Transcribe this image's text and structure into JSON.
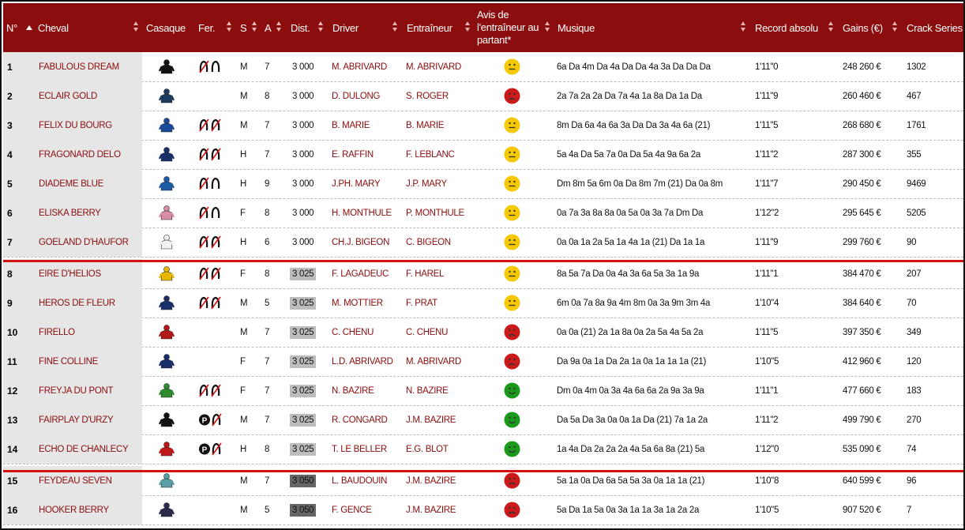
{
  "header": {
    "num": "N°",
    "cheval": "Cheval",
    "casaque": "Casaque",
    "fer": "Fer.",
    "s": "S",
    "a": "A",
    "dist": "Dist.",
    "driver": "Driver",
    "entraineur": "Entraîneur",
    "avis_l1": "Avis de",
    "avis_l2": "l'entraîneur au",
    "avis_l3": "partant*",
    "musique": "Musique",
    "record": "Record absolu",
    "gains": "Gains (€)",
    "crack": "Crack Series"
  },
  "colors": {
    "header_bg": "#8b0d0d",
    "separator": "#d41111",
    "good": "#1a9a1a",
    "neutral": "#f5c800",
    "bad": "#cc1a1a"
  },
  "rows": [
    {
      "num": "1",
      "cheval": "FABULOUS DREAM",
      "casaque": "jockey-silk-black",
      "casaque_color": "#111111",
      "fer": "D4 shoes",
      "fer_icon": "horseshoe-partial-icon",
      "s": "M",
      "a": "7",
      "dist": "3 000",
      "dist_style": "plain",
      "driver": "M. ABRIVARD",
      "entraineur": "M. ABRIVARD",
      "avis": "neutral",
      "musique": "6a Da 4m Da 4a Da Da 4a 3a Da Da Da",
      "record": "1'11\"0",
      "gains": "248 260 €",
      "crack": "1302"
    },
    {
      "num": "2",
      "cheval": "ECLAIR GOLD",
      "casaque": "jockey-silk-navy",
      "casaque_color": "#1d3b5c",
      "fer": "",
      "fer_icon": "",
      "s": "M",
      "a": "8",
      "dist": "3 000",
      "dist_style": "plain",
      "driver": "D. DULONG",
      "entraineur": "S. ROGER",
      "avis": "bad",
      "musique": "2a 7a 2a 2a Da 7a 4a 1a 8a Da 1a Da",
      "record": "1'11\"9",
      "gains": "260 460 €",
      "crack": "467"
    },
    {
      "num": "3",
      "cheval": "FELIX DU BOURG",
      "casaque": "jockey-silk-multi",
      "casaque_color": "#1a4a9a",
      "fer": "D4",
      "fer_icon": "horseshoe-crossed-icon",
      "s": "M",
      "a": "7",
      "dist": "3 000",
      "dist_style": "plain",
      "driver": "B. MARIE",
      "entraineur": "B. MARIE",
      "avis": "neutral",
      "musique": "8m Da 6a 4a 6a 3a Da Da 3a 4a 6a (21)",
      "record": "1'11\"5",
      "gains": "268 680 €",
      "crack": "1761"
    },
    {
      "num": "4",
      "cheval": "FRAGONARD DELO",
      "casaque": "jockey-silk-navy",
      "casaque_color": "#1a2f6a",
      "fer": "D4",
      "fer_icon": "horseshoe-crossed-icon",
      "s": "H",
      "a": "7",
      "dist": "3 000",
      "dist_style": "plain",
      "driver": "E. RAFFIN",
      "entraineur": "F. LEBLANC",
      "avis": "neutral",
      "musique": "5a 4a Da 5a 7a 0a Da 5a 4a 9a 6a 2a",
      "record": "1'11\"2",
      "gains": "287 300 €",
      "crack": "355"
    },
    {
      "num": "5",
      "cheval": "DIADEME BLUE",
      "casaque": "jockey-silk-blue",
      "casaque_color": "#1e5ca8",
      "fer": "DA",
      "fer_icon": "horseshoe-partial-icon",
      "s": "H",
      "a": "9",
      "dist": "3 000",
      "dist_style": "plain",
      "driver": "J.PH. MARY",
      "entraineur": "J.P. MARY",
      "avis": "neutral",
      "musique": "Dm 8m 5a 6m 0a Da 8m 7m (21) Da 0a 8m",
      "record": "1'11\"7",
      "gains": "290 450 €",
      "crack": "9469"
    },
    {
      "num": "6",
      "cheval": "ELISKA BERRY",
      "casaque": "jockey-silk-pink",
      "casaque_color": "#d98ca8",
      "fer": "DA",
      "fer_icon": "horseshoe-partial-icon",
      "s": "F",
      "a": "8",
      "dist": "3 000",
      "dist_style": "plain",
      "driver": "H. MONTHULE",
      "entraineur": "P. MONTHULE",
      "avis": "neutral",
      "musique": "0a 7a 3a 8a 8a 0a 5a 0a 3a 7a Dm Da",
      "record": "1'12\"2",
      "gains": "295 645 €",
      "crack": "5205"
    },
    {
      "num": "7",
      "cheval": "GOELAND D'HAUFOR",
      "casaque": "jockey-silk-white",
      "casaque_color": "#f2f2f2",
      "fer": "D4",
      "fer_icon": "horseshoe-crossed-icon",
      "s": "H",
      "a": "6",
      "dist": "3 000",
      "dist_style": "plain",
      "driver": "CH.J. BIGEON",
      "entraineur": "C. BIGEON",
      "avis": "neutral",
      "musique": "0a 0a 1a 2a 5a 1a 4a 1a (21) Da 1a 1a",
      "record": "1'11\"9",
      "gains": "299 760 €",
      "crack": "90"
    },
    {
      "num": "8",
      "cheval": "EIRE D'HELIOS",
      "casaque": "jockey-silk-yellow-red",
      "casaque_color": "#e8b800",
      "fer": "D4",
      "fer_icon": "horseshoe-crossed-icon",
      "s": "F",
      "a": "8",
      "dist": "3 025",
      "dist_style": "light",
      "driver": "F. LAGADEUC",
      "entraineur": "F. HAREL",
      "avis": "neutral",
      "musique": "8a 5a 7a Da 0a 4a 3a 6a 5a 3a 1a 9a",
      "record": "1'11\"1",
      "gains": "384 470 €",
      "crack": "207"
    },
    {
      "num": "9",
      "cheval": "HEROS DE FLEUR",
      "casaque": "jockey-silk-navy",
      "casaque_color": "#1a2f6a",
      "fer": "D4",
      "fer_icon": "horseshoe-crossed-icon",
      "s": "M",
      "a": "5",
      "dist": "3 025",
      "dist_style": "light",
      "driver": "M. MOTTIER",
      "entraineur": "F. PRAT",
      "avis": "neutral",
      "musique": "6m 0a 7a 8a 9a 4m 8m 0a 3a 9m 3m 4a",
      "record": "1'10\"4",
      "gains": "384 640 €",
      "crack": "70"
    },
    {
      "num": "10",
      "cheval": "FIRELLO",
      "casaque": "jockey-silk-red",
      "casaque_color": "#b01818",
      "fer": "",
      "fer_icon": "",
      "s": "M",
      "a": "7",
      "dist": "3 025",
      "dist_style": "light",
      "driver": "C. CHENU",
      "entraineur": "C. CHENU",
      "avis": "bad",
      "musique": "0a 0a (21) 2a 1a 8a 0a 2a 5a 4a 5a 2a",
      "record": "1'11\"5",
      "gains": "397 350 €",
      "crack": "349"
    },
    {
      "num": "11",
      "cheval": "FINE COLLINE",
      "casaque": "jockey-silk-navy",
      "casaque_color": "#1a2f6a",
      "fer": "",
      "fer_icon": "",
      "s": "F",
      "a": "7",
      "dist": "3 025",
      "dist_style": "light",
      "driver": "L.D. ABRIVARD",
      "entraineur": "M. ABRIVARD",
      "avis": "bad",
      "musique": "Da 9a 0a 1a Da 2a 1a 0a 1a 1a 1a (21)",
      "record": "1'10\"5",
      "gains": "412 960 €",
      "crack": "120"
    },
    {
      "num": "12",
      "cheval": "FREYJA DU PONT",
      "casaque": "jockey-silk-green-yellow",
      "casaque_color": "#2e8b2e",
      "fer": "D4",
      "fer_icon": "horseshoe-crossed-icon",
      "s": "F",
      "a": "7",
      "dist": "3 025",
      "dist_style": "light",
      "driver": "N. BAZIRE",
      "entraineur": "N. BAZIRE",
      "avis": "good",
      "musique": "Dm 0a 4m 0a 3a 4a 6a 6a 2a 9a 3a 9a",
      "record": "1'11\"1",
      "gains": "477 660 €",
      "crack": "183"
    },
    {
      "num": "13",
      "cheval": "FAIRPLAY D'URZY",
      "casaque": "jockey-silk-black",
      "casaque_color": "#111111",
      "fer": "P",
      "fer_icon": "plaque-crossed-icon",
      "s": "M",
      "a": "7",
      "dist": "3 025",
      "dist_style": "light",
      "driver": "R. CONGARD",
      "entraineur": "J.M. BAZIRE",
      "avis": "good",
      "musique": "Da 5a Da 3a 0a 0a 1a Da (21) 7a 1a 2a",
      "record": "1'11\"2",
      "gains": "499 790 €",
      "crack": "270"
    },
    {
      "num": "14",
      "cheval": "ECHO DE CHANLECY",
      "casaque": "jockey-silk-red",
      "casaque_color": "#c01818",
      "fer": "P",
      "fer_icon": "plaque-crossed-icon",
      "s": "H",
      "a": "8",
      "dist": "3 025",
      "dist_style": "light",
      "driver": "T. LE BELLER",
      "entraineur": "E.G. BLOT",
      "avis": "good",
      "musique": "1a 4a Da 2a 2a 2a 4a 5a 6a 8a (21) 5a",
      "record": "1'12\"0",
      "gains": "535 090 €",
      "crack": "74"
    },
    {
      "num": "15",
      "cheval": "FEYDEAU SEVEN",
      "casaque": "jockey-silk-teal",
      "casaque_color": "#5a9ea8",
      "fer": "",
      "fer_icon": "",
      "s": "M",
      "a": "7",
      "dist": "3 050",
      "dist_style": "dark",
      "driver": "L. BAUDOUIN",
      "entraineur": "J.M. BAZIRE",
      "avis": "bad",
      "musique": "5a 1a 0a Da 6a 5a 5a 3a 0a 1a 1a (21)",
      "record": "1'10\"8",
      "gains": "640 599 €",
      "crack": "96"
    },
    {
      "num": "16",
      "cheval": "HOOKER BERRY",
      "casaque": "jockey-silk-checked",
      "casaque_color": "#2a2a4a",
      "fer": "",
      "fer_icon": "",
      "s": "M",
      "a": "5",
      "dist": "3 050",
      "dist_style": "dark",
      "driver": "F. GENCE",
      "entraineur": "J.M. BAZIRE",
      "avis": "bad",
      "musique": "5a Da 1a 5a 0a 3a 1a 1a 3a 1a 2a 2a",
      "record": "1'10\"5",
      "gains": "907 520 €",
      "crack": "7"
    }
  ]
}
